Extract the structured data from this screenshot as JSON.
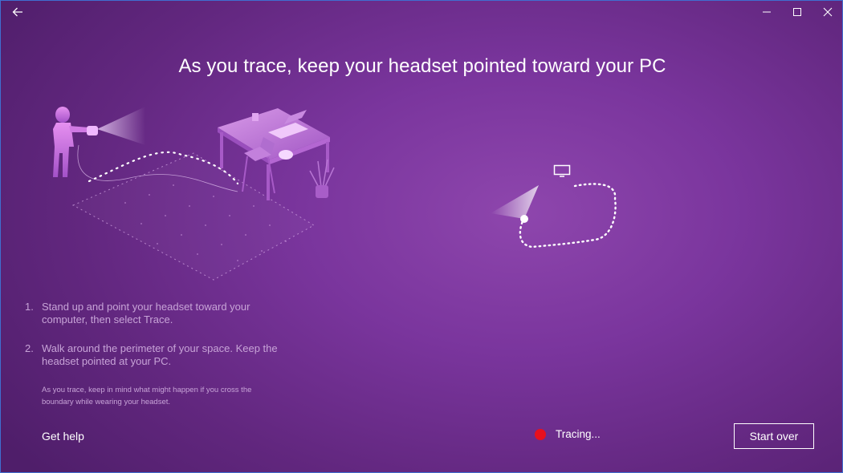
{
  "window": {
    "back_icon": "arrow-left-icon",
    "minimize_icon": "minimize-icon",
    "maximize_icon": "maximize-icon",
    "close_icon": "close-icon"
  },
  "title": "As you trace, keep your headset pointed toward your PC",
  "instructions": [
    {
      "number": "1.",
      "text": "Stand up and point your headset toward your computer, then select Trace."
    },
    {
      "number": "2.",
      "text": "Walk around the perimeter of your space. Keep the headset pointed at your PC."
    }
  ],
  "note": "As you trace, keep in mind what might happen if you cross the boundary while wearing your headset.",
  "get_help": "Get help",
  "status": {
    "label": "Tracing...",
    "color": "#e8101e"
  },
  "start_over": "Start over",
  "colors": {
    "background": "#7a359d",
    "text_muted": "#c7a3d7"
  }
}
